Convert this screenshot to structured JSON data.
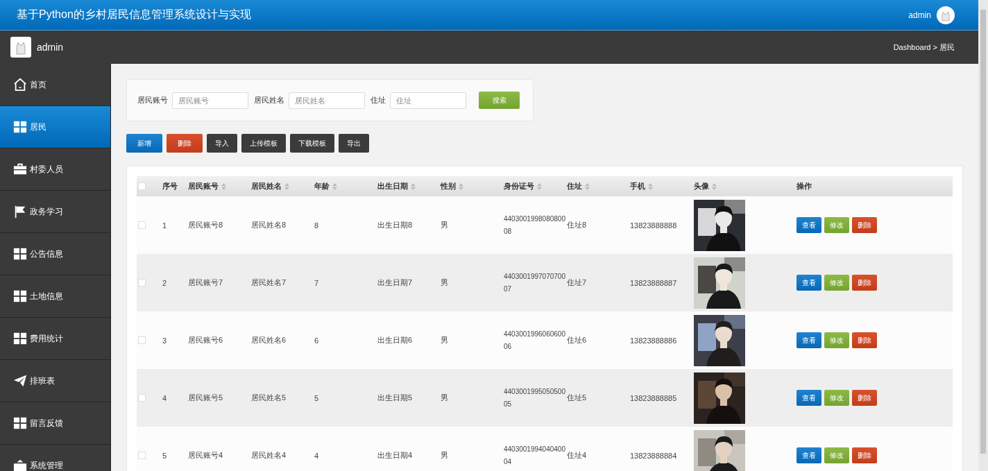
{
  "header": {
    "title": "基于Python的乡村居民信息管理系统设计与实现",
    "user": "admin"
  },
  "subbar": {
    "user": "admin",
    "breadcrumb": "Dashboard > 居民"
  },
  "sidebar": {
    "items": [
      {
        "label": "首页",
        "kind": "home",
        "selected": false
      },
      {
        "label": "居民",
        "kind": "grid",
        "selected": true
      },
      {
        "label": "村委人员",
        "kind": "briefcase",
        "selected": false
      },
      {
        "label": "政务学习",
        "kind": "flag",
        "selected": false
      },
      {
        "label": "公告信息",
        "kind": "grid",
        "selected": false
      },
      {
        "label": "土地信息",
        "kind": "grid",
        "selected": false
      },
      {
        "label": "费用统计",
        "kind": "grid",
        "selected": false
      },
      {
        "label": "排班表",
        "kind": "plane",
        "selected": false
      },
      {
        "label": "留言反馈",
        "kind": "grid",
        "selected": false
      },
      {
        "label": "系统管理",
        "kind": "tray",
        "selected": false
      }
    ]
  },
  "search": {
    "fields": [
      {
        "label": "居民账号",
        "placeholder": "居民账号"
      },
      {
        "label": "居民姓名",
        "placeholder": "居民姓名"
      },
      {
        "label": "住址",
        "placeholder": "住址"
      }
    ],
    "button": "搜索"
  },
  "toolbar": [
    {
      "label": "新增",
      "kind": "primary"
    },
    {
      "label": "删除",
      "kind": "danger"
    },
    {
      "label": "导入",
      "kind": "dark"
    },
    {
      "label": "上传模板",
      "kind": "dark"
    },
    {
      "label": "下载模板",
      "kind": "dark"
    },
    {
      "label": "导出",
      "kind": "dark"
    }
  ],
  "table": {
    "columns": [
      {
        "label": "序号",
        "sortable": false
      },
      {
        "label": "居民账号",
        "sortable": true
      },
      {
        "label": "居民姓名",
        "sortable": true
      },
      {
        "label": "年龄",
        "sortable": true
      },
      {
        "label": "出生日期",
        "sortable": true
      },
      {
        "label": "性别",
        "sortable": true
      },
      {
        "label": "身份证号",
        "sortable": true
      },
      {
        "label": "住址",
        "sortable": true
      },
      {
        "label": "手机",
        "sortable": true
      },
      {
        "label": "头像",
        "sortable": true
      },
      {
        "label": "操作",
        "sortable": false
      }
    ],
    "header_checked": false,
    "rows": [
      {
        "checked": false,
        "cells": [
          "1",
          "居民账号8",
          "居民姓名8",
          "8",
          "出生日期8",
          "男",
          "440300199808080008",
          "住址8",
          "13823888888"
        ],
        "avatar": {
          "kind": "picture"
        },
        "actions": [
          {
            "label": "查看",
            "kind": "primary"
          },
          {
            "label": "修改",
            "kind": "success"
          },
          {
            "label": "删除",
            "kind": "danger"
          }
        ]
      },
      {
        "checked": false,
        "cells": [
          "2",
          "居民账号7",
          "居民姓名7",
          "7",
          "出生日期7",
          "男",
          "440300199707070007",
          "住址7",
          "13823888887"
        ],
        "avatar": {
          "kind": "picture"
        },
        "actions": [
          {
            "label": "查看",
            "kind": "primary"
          },
          {
            "label": "修改",
            "kind": "success"
          },
          {
            "label": "删除",
            "kind": "danger"
          }
        ]
      },
      {
        "checked": false,
        "cells": [
          "3",
          "居民账号6",
          "居民姓名6",
          "6",
          "出生日期6",
          "男",
          "440300199606060006",
          "住址6",
          "13823888886"
        ],
        "avatar": {
          "kind": "picture"
        },
        "actions": [
          {
            "label": "查看",
            "kind": "primary"
          },
          {
            "label": "修改",
            "kind": "success"
          },
          {
            "label": "删除",
            "kind": "danger"
          }
        ]
      },
      {
        "checked": false,
        "cells": [
          "4",
          "居民账号5",
          "居民姓名5",
          "5",
          "出生日期5",
          "男",
          "440300199505050005",
          "住址5",
          "13823888885"
        ],
        "avatar": {
          "kind": "picture"
        },
        "actions": [
          {
            "label": "查看",
            "kind": "primary"
          },
          {
            "label": "修改",
            "kind": "success"
          },
          {
            "label": "删除",
            "kind": "danger"
          }
        ]
      },
      {
        "checked": false,
        "cells": [
          "5",
          "居民账号4",
          "居民姓名4",
          "4",
          "出生日期4",
          "男",
          "440300199404040004",
          "住址4",
          "13823888884"
        ],
        "avatar": {
          "kind": "picture"
        },
        "actions": [
          {
            "label": "查看",
            "kind": "primary"
          },
          {
            "label": "修改",
            "kind": "success"
          },
          {
            "label": "删除",
            "kind": "danger"
          }
        ]
      }
    ]
  }
}
